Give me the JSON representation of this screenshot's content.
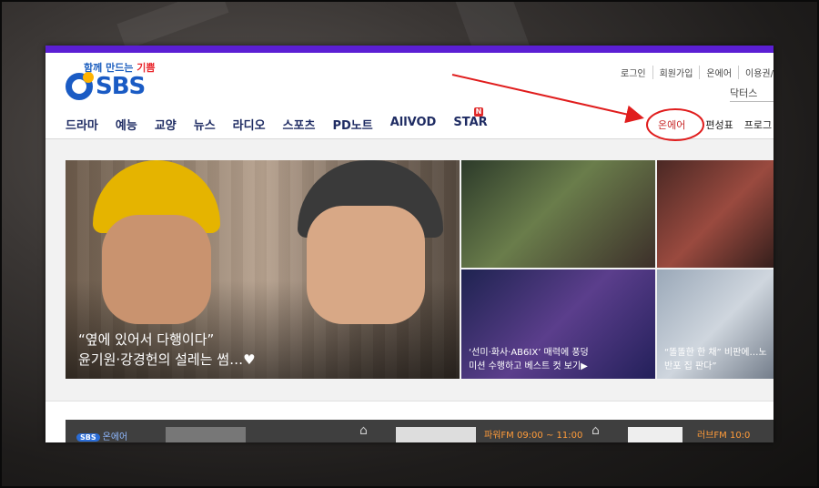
{
  "brand": {
    "slogan_a": "함께 만드는 ",
    "slogan_b": "기쁨",
    "logo_text": "SBS"
  },
  "util_links": [
    "로그인",
    "회원가입",
    "온에어",
    "이용권/머"
  ],
  "search": {
    "value": "닥터스"
  },
  "nav": {
    "items": [
      "드라마",
      "예능",
      "교양",
      "뉴스",
      "라디오",
      "스포츠",
      "PD노트",
      "AllVOD",
      "STAR"
    ],
    "new_badge": "N",
    "right_items": [
      "온에어",
      "편성표",
      "프로그"
    ]
  },
  "hero": {
    "line1": "“옆에 있어서 다행이다”",
    "line2": "윤기원·강경헌의 설레는 썸…♥"
  },
  "tiles": [
    {
      "caption_l1": "‘선미·화사·AB6IX’ 매력에 풍덩",
      "caption_l2": "미션 수행하고 베스트 컷 보기▶"
    },
    {
      "caption_l1": "“똘똘한 한 채” 비판에…노",
      "caption_l2": "반포 집 판다”"
    }
  ],
  "bottom": {
    "onair_badge": "SBS",
    "onair_label": "온에어",
    "radio_a": "파워FM 09:00 ~ 11:00",
    "radio_b": "러브FM 10:0"
  },
  "colors": {
    "accent": "#5b1fd4",
    "brand_blue": "#1a5bc4",
    "annotation_red": "#e01d1d"
  }
}
